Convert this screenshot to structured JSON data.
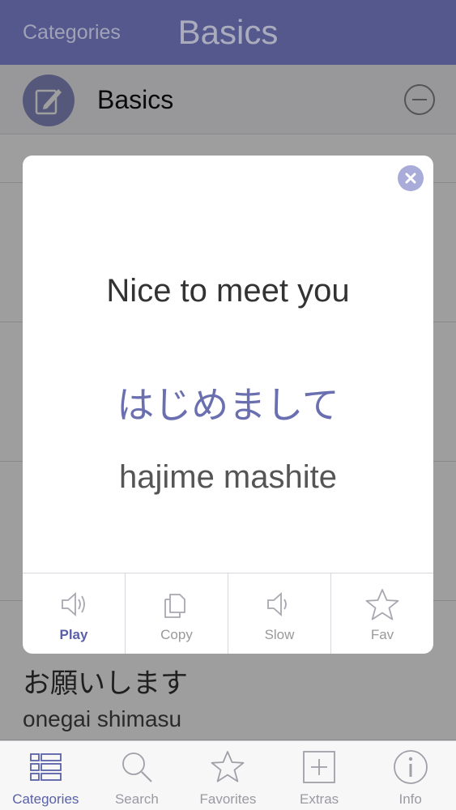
{
  "navbar": {
    "back_label": "Categories",
    "title": "Basics"
  },
  "category": {
    "title": "Basics"
  },
  "list": {
    "last_item": {
      "native": "お願いします",
      "roman": "onegai shimasu"
    }
  },
  "modal": {
    "english": "Nice to meet you",
    "native": "はじめまして",
    "romanization": "hajime mashite",
    "actions": [
      {
        "label": "Play",
        "icon": "speaker-icon",
        "active": true
      },
      {
        "label": "Copy",
        "icon": "copy-icon",
        "active": false
      },
      {
        "label": "Slow",
        "icon": "speaker-slow-icon",
        "active": false
      },
      {
        "label": "Fav",
        "icon": "star-icon",
        "active": false
      }
    ]
  },
  "tabbar": {
    "tabs": [
      {
        "label": "Categories",
        "icon": "list-icon",
        "active": true
      },
      {
        "label": "Search",
        "icon": "search-icon",
        "active": false
      },
      {
        "label": "Favorites",
        "icon": "star-icon",
        "active": false
      },
      {
        "label": "Extras",
        "icon": "plus-box-icon",
        "active": false
      },
      {
        "label": "Info",
        "icon": "info-icon",
        "active": false
      }
    ]
  },
  "colors": {
    "accent": "#6a6fb0",
    "active_label": "#5a60a8"
  }
}
